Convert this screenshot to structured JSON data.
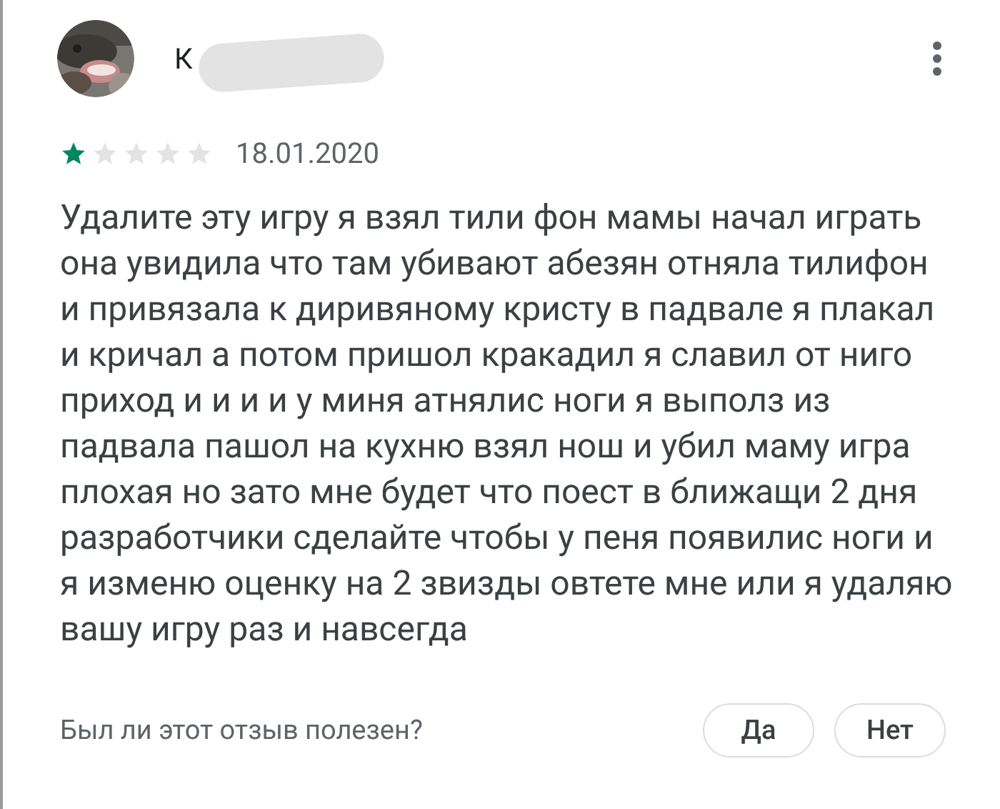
{
  "review": {
    "author": "К",
    "stars": 1,
    "date": "18.01.2020",
    "lines": [
      "Удалите эту игру я взял тили фон мамы начал играть",
      "она увидила что там убивают абезян отняла тилифон",
      "и привязала к диривяному кристу в падвале я плакал",
      "и кричал а потом пришол кракадил я славил от ниго",
      "приход и и и и у миня атнялис ноги я выполз из",
      "падвала пашол на кухню взял нош и убил маму игра",
      "плохая но зато мне будет что поест в ближащи 2 дня",
      "разработчики сделайте чтобы у пеня появилис ноги и",
      "я изменю оценку на 2 звизды овтете мне или я удаляю",
      "вашу игру раз и навсегда"
    ]
  },
  "helpful": {
    "question": "Был ли этот отзыв полезен?",
    "buttons": [
      "Да",
      "Нет"
    ]
  }
}
